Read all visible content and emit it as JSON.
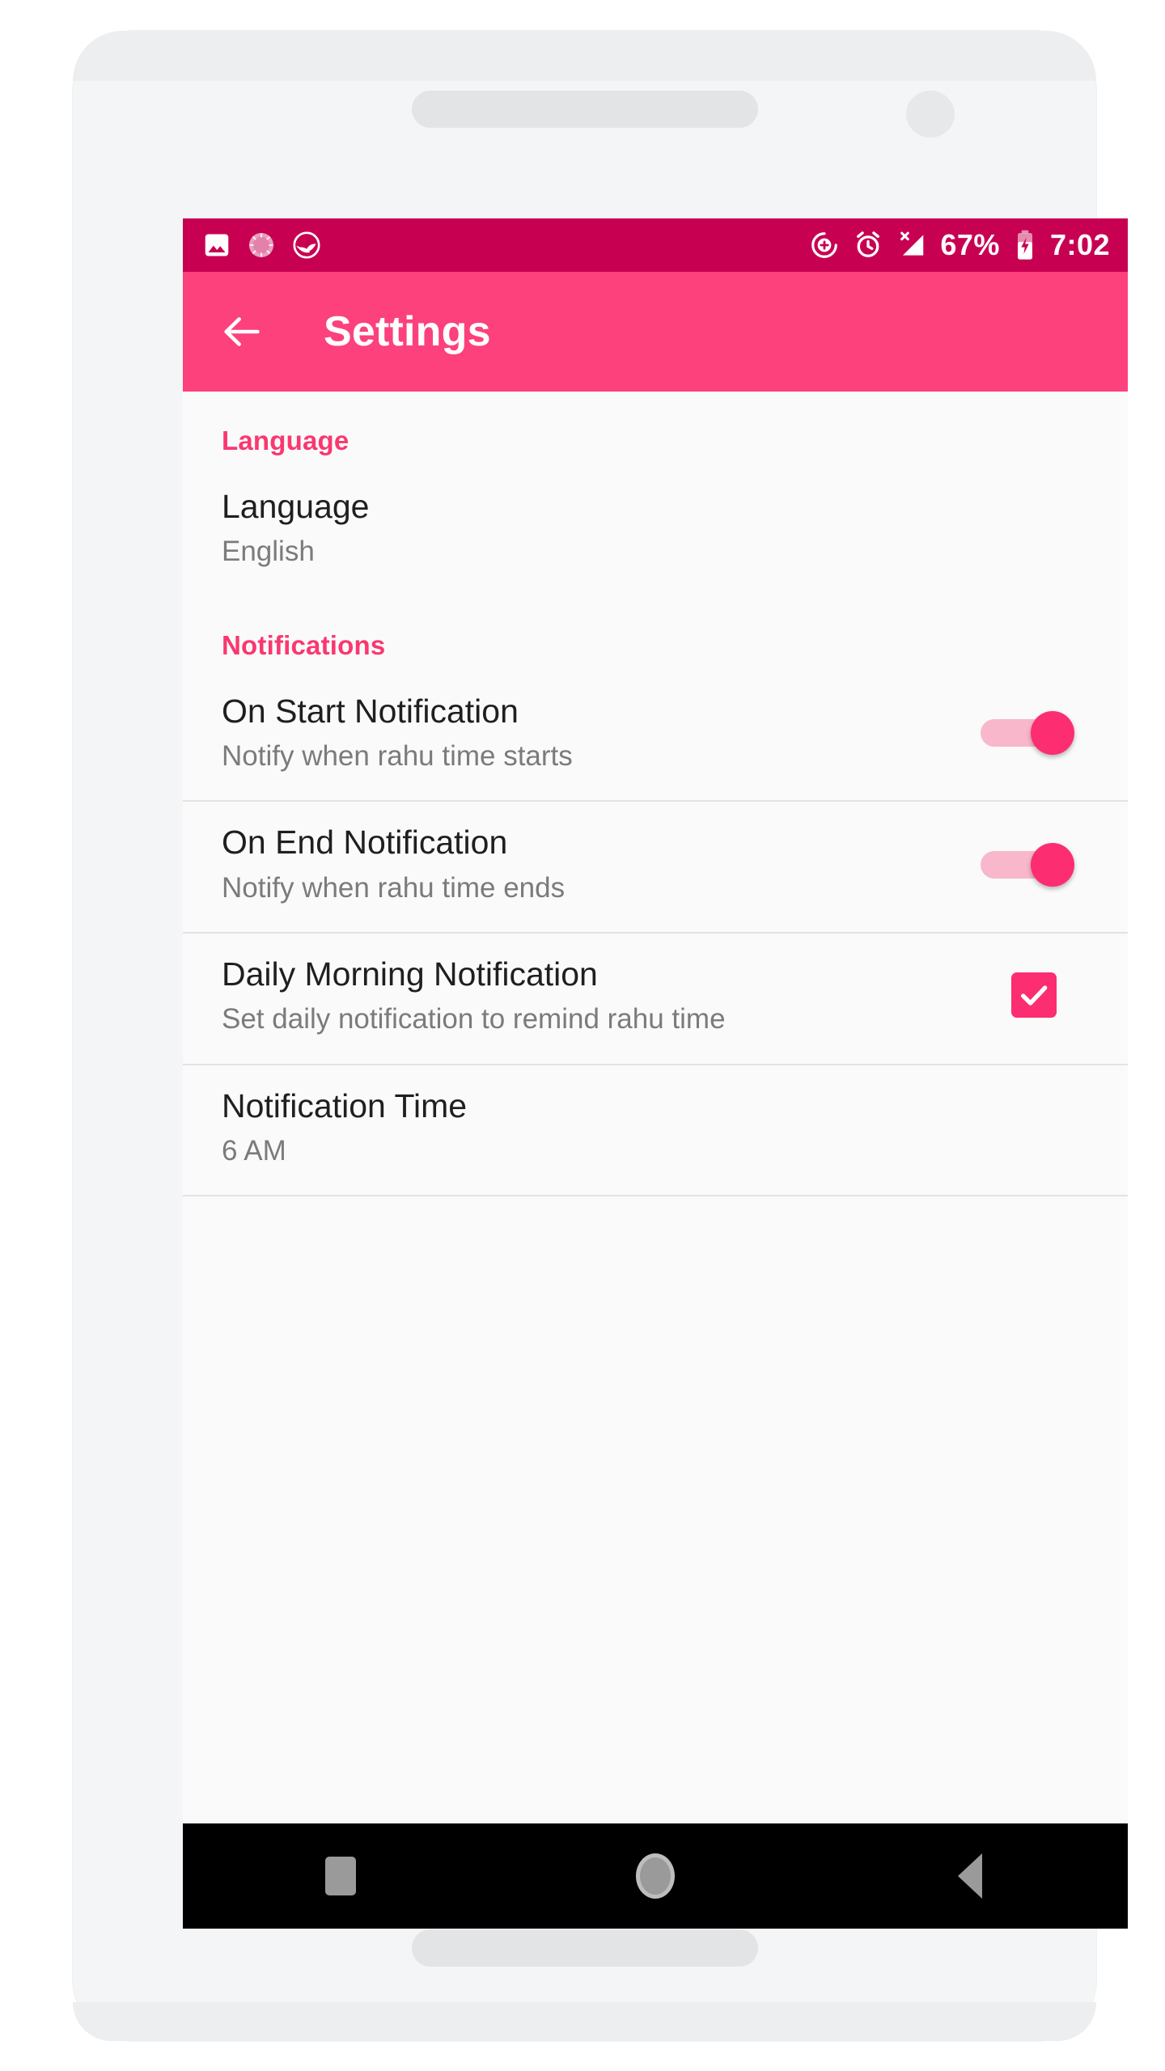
{
  "status_bar": {
    "background": "#c80052",
    "notification_icons": [
      "image-icon",
      "sunburst-icon",
      "app-logo-icon"
    ],
    "system_icons": [
      "add-circle-icon",
      "alarm-icon",
      "no-signal-icon"
    ],
    "battery_percent": "67%",
    "battery_state": "charging",
    "time": "7:02"
  },
  "app_bar": {
    "background": "#fc417d",
    "back_label": "back-arrow",
    "title": "Settings"
  },
  "sections": [
    {
      "header": "Language",
      "rows": [
        {
          "title": "Language",
          "subtitle": "English",
          "control": "none",
          "divider_after": false
        }
      ]
    },
    {
      "header": "Notifications",
      "rows": [
        {
          "title": "On Start Notification",
          "subtitle": "Notify when rahu time starts",
          "control": "switch",
          "control_state": "on",
          "divider_after": true
        },
        {
          "title": "On End Notification",
          "subtitle": "Notify when rahu time ends",
          "control": "switch",
          "control_state": "on",
          "divider_after": true
        },
        {
          "title": "Daily Morning Notification",
          "subtitle": "Set daily notification to remind rahu time",
          "control": "checkbox",
          "control_state": "checked",
          "divider_after": true
        },
        {
          "title": "Notification Time",
          "subtitle": "6 AM",
          "control": "none",
          "divider_after": true
        }
      ]
    }
  ],
  "nav_bar": {
    "background": "#000000",
    "buttons": [
      "recents-square-icon",
      "home-circle-icon",
      "back-triangle-icon"
    ]
  },
  "colors": {
    "status_bar": "#c80052",
    "app_bar": "#fc417d",
    "accent_pink": "#f9386f",
    "control_pink": "#fc2d70",
    "screen_background": "#fafafa",
    "title_text": "#1f1f1f",
    "subtitle_text": "#7b7b7b",
    "divider": "#e3e3e3"
  }
}
